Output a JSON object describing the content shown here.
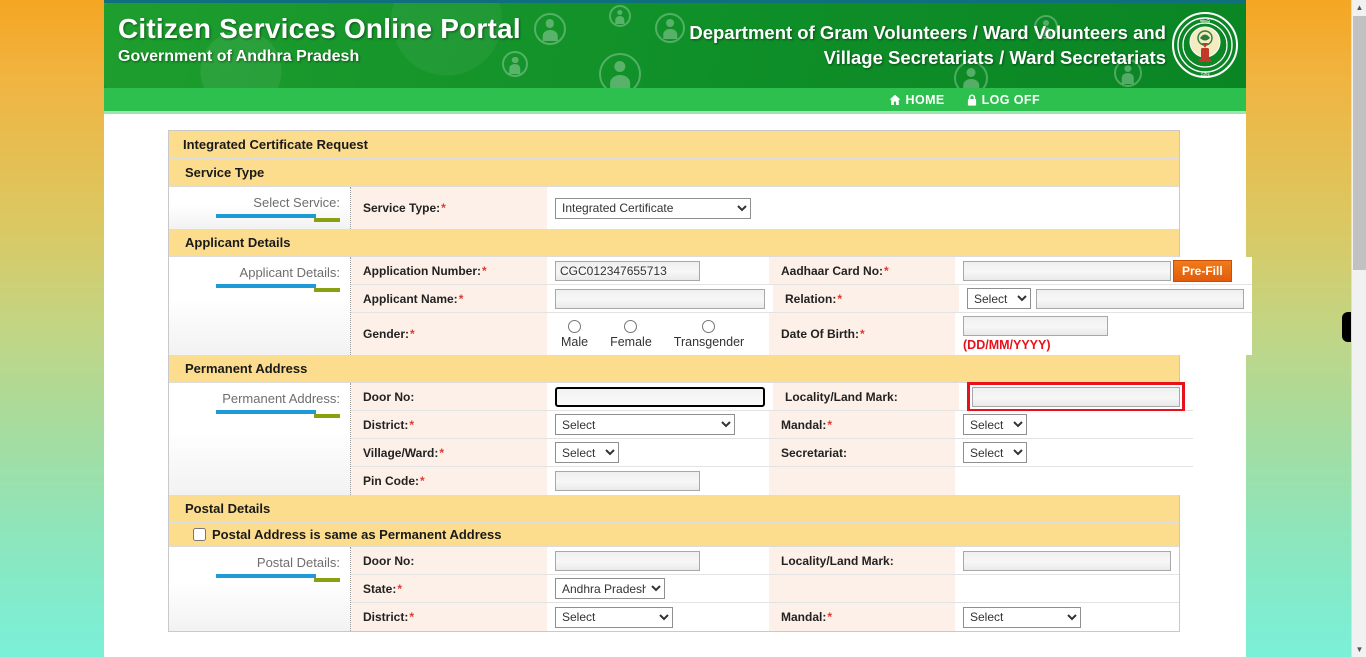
{
  "header": {
    "site_title": "Citizen Services Online Portal",
    "site_subtitle": "Government of Andhra Pradesh",
    "dept_line1": "Department of Gram Volunteers / Ward Volunteers and",
    "dept_line2": "Village Secretariats / Ward Secretariats",
    "emblem_name": "andhra-pradesh-emblem"
  },
  "nav": {
    "home": "HOME",
    "logoff": "LOG OFF"
  },
  "form": {
    "page_title": "Integrated Certificate Request",
    "sections": {
      "service_type": {
        "heading": "Service Type",
        "side_label": "Select Service:",
        "label": "Service Type:",
        "value": "Integrated Certificate"
      },
      "applicant": {
        "heading": "Applicant Details",
        "side_label": "Applicant Details:",
        "application_number_label": "Application Number:",
        "application_number_value": "CGC012347655713",
        "aadhaar_label": "Aadhaar Card No:",
        "aadhaar_value": "",
        "prefill_label": "Pre-Fill",
        "applicant_name_label": "Applicant Name:",
        "applicant_name_value": "",
        "relation_label": "Relation:",
        "relation_value": "Select",
        "relation_text_value": "",
        "gender_label": "Gender:",
        "gender_options": [
          "Male",
          "Female",
          "Transgender"
        ],
        "dob_label": "Date Of Birth:",
        "dob_value": "",
        "dob_hint": "(DD/MM/YYYY)"
      },
      "permanent_address": {
        "heading": "Permanent Address",
        "side_label": "Permanent Address:",
        "door_no_label": "Door No:",
        "door_no_value": "",
        "locality_label": "Locality/Land Mark:",
        "locality_value": "",
        "district_label": "District:",
        "district_value": "Select",
        "mandal_label": "Mandal:",
        "mandal_value": "Select",
        "village_label": "Village/Ward:",
        "village_value": "Select",
        "secretariat_label": "Secretariat:",
        "secretariat_value": "Select",
        "pincode_label": "Pin Code:",
        "pincode_value": ""
      },
      "postal": {
        "heading": "Postal Details",
        "same_as_permanent": "Postal Address is same as Permanent Address",
        "side_label": "Postal Details:",
        "door_no_label": "Door No:",
        "door_no_value": "",
        "locality_label": "Locality/Land Mark:",
        "locality_value": "",
        "state_label": "State:",
        "state_value": "Andhra Pradesh",
        "district_label": "District:",
        "district_value": "Select",
        "mandal_label": "Mandal:",
        "mandal_value": "Select"
      }
    }
  },
  "colors": {
    "banner_green": "#0f8f28",
    "nav_green": "#2ec04e",
    "section_header": "#fcdd8e",
    "label_bg": "#fdf0e8",
    "required_red": "#e03a2f",
    "highlight_red": "#e8101a",
    "prefill_orange": "#e25c0c",
    "underline_blue": "#1e9bd7",
    "underline_olive": "#8aa00f"
  }
}
